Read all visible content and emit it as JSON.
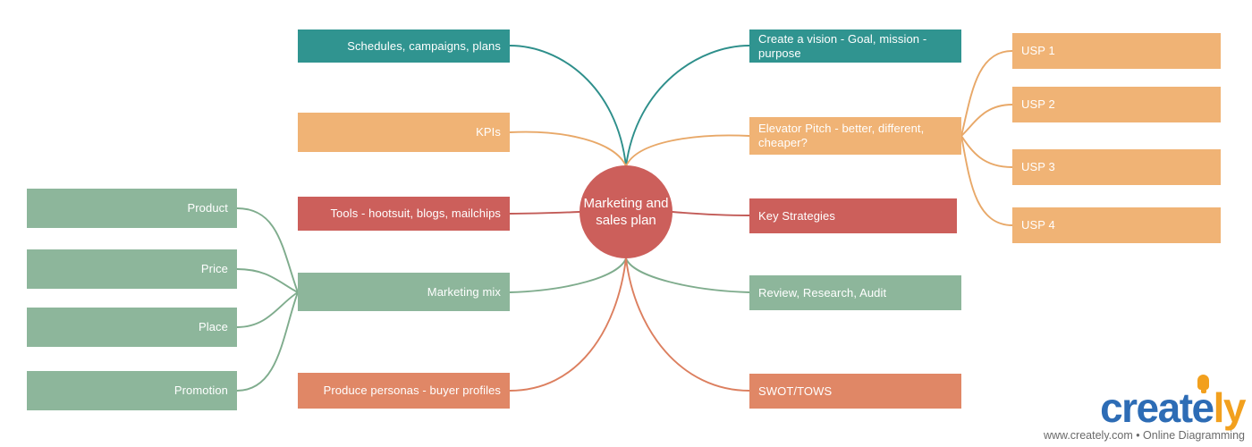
{
  "diagram": {
    "title": "Marketing and sales plan mind map",
    "center": {
      "label": "Marketing and sales plan",
      "color": "#CC5F5B"
    },
    "palette": {
      "teal": "#309490",
      "orange": "#F0B375",
      "red": "#CC5F5B",
      "green": "#8DB69B",
      "coral": "#E08766",
      "background": "#FFFFFF",
      "text": "#FFFFFF"
    },
    "branches_left": [
      {
        "label": "Schedules, campaigns, plans",
        "color": "#309490"
      },
      {
        "label": "KPIs",
        "color": "#F0B375"
      },
      {
        "label": "Tools - hootsuit, blogs, mailchips",
        "color": "#CC5F5B"
      },
      {
        "label": "Marketing mix",
        "color": "#8DB69B"
      },
      {
        "label": "Produce personas - buyer profiles",
        "color": "#E08766"
      }
    ],
    "branches_right": [
      {
        "label": "Create a vision - Goal, mission - purpose",
        "color": "#309490"
      },
      {
        "label": "Elevator Pitch - better, different, cheaper?",
        "color": "#F0B375"
      },
      {
        "label": "Key Strategies",
        "color": "#CC5F5B"
      },
      {
        "label": "Review, Research, Audit",
        "color": "#8DB69B"
      },
      {
        "label": "SWOT/TOWS",
        "color": "#E08766"
      }
    ],
    "marketing_mix_children": [
      {
        "label": "Product",
        "color": "#8DB69B"
      },
      {
        "label": "Price",
        "color": "#8DB69B"
      },
      {
        "label": "Place",
        "color": "#8DB69B"
      },
      {
        "label": "Promotion",
        "color": "#8DB69B"
      }
    ],
    "usp_children": [
      {
        "label": "USP 1",
        "color": "#F0B375"
      },
      {
        "label": "USP 2",
        "color": "#F0B375"
      },
      {
        "label": "USP 3",
        "color": "#F0B375"
      },
      {
        "label": "USP 4",
        "color": "#F0B375"
      }
    ]
  },
  "footer": {
    "brand_part1": "creat",
    "brand_part2": "e",
    "brand_part3": "ly",
    "tagline": "www.creately.com • Online Diagramming"
  }
}
